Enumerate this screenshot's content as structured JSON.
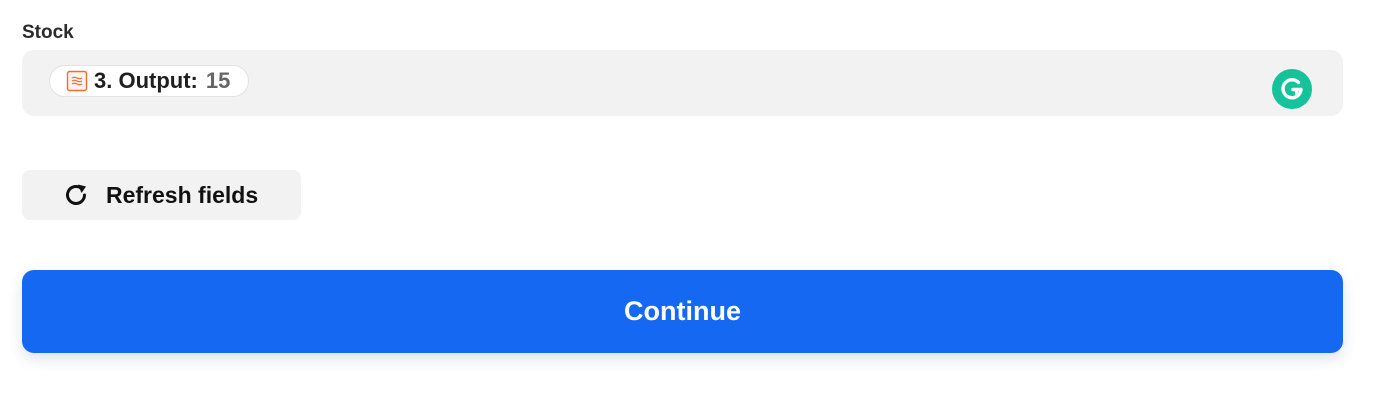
{
  "field": {
    "label": "Stock",
    "token": {
      "label": "3. Output:",
      "value": "15",
      "icon": "formatter-step-icon"
    },
    "extension_icon": "grammarly-icon"
  },
  "actions": {
    "refresh_label": "Refresh fields",
    "refresh_icon": "refresh-icon",
    "continue_label": "Continue"
  },
  "colors": {
    "field_background": "#f2f2f2",
    "token_icon": "#f26b3a",
    "grammarly": "#15c39a",
    "primary": "#1568f2"
  }
}
